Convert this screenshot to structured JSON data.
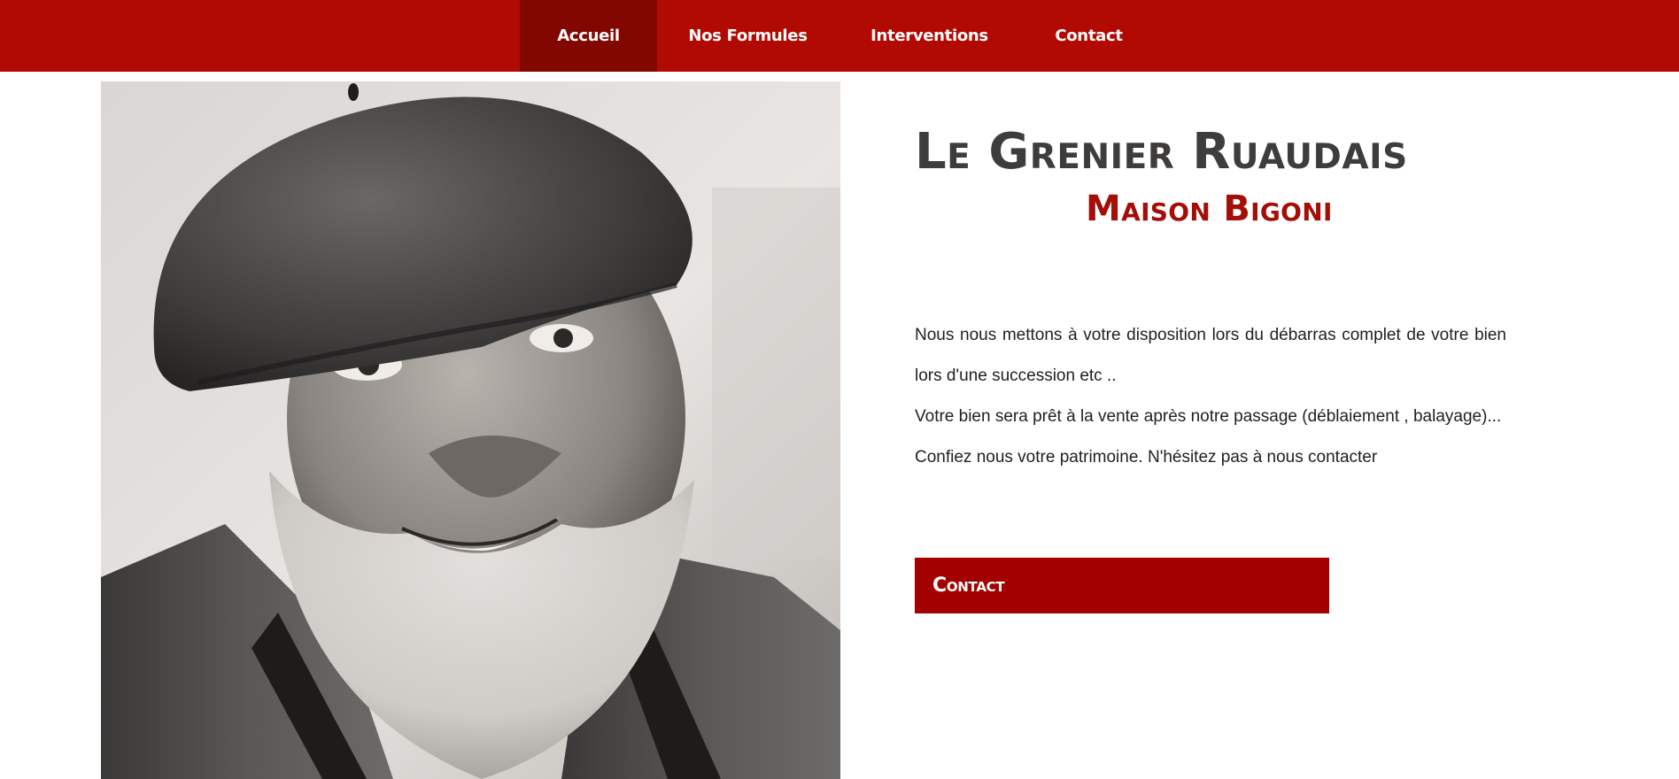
{
  "nav": {
    "items": [
      {
        "label": "Accueil",
        "active": true
      },
      {
        "label": "Nos Formules",
        "active": false
      },
      {
        "label": "Interventions",
        "active": false
      },
      {
        "label": "Contact",
        "active": false
      }
    ]
  },
  "hero": {
    "title": "Le Grenier Ruaudais",
    "subtitle": "Maison Bigoni",
    "paragraphs": [
      "Nous nous mettons à votre disposition lors du débarras complet de votre bien lors d'une succession etc ..",
      "Votre bien sera prêt à la vente après notre passage (déblaiement , balayage)...",
      "Confiez nous votre patrimoine. N'hésitez pas à nous contacter"
    ],
    "button_label": "Contact"
  },
  "colors": {
    "nav_background": "#b10a02",
    "nav_active": "#820701",
    "title": "#3f3d3c",
    "subtitle": "#a30e06",
    "button": "#a30101"
  },
  "icons": {
    "photo": "portrait-photo"
  }
}
